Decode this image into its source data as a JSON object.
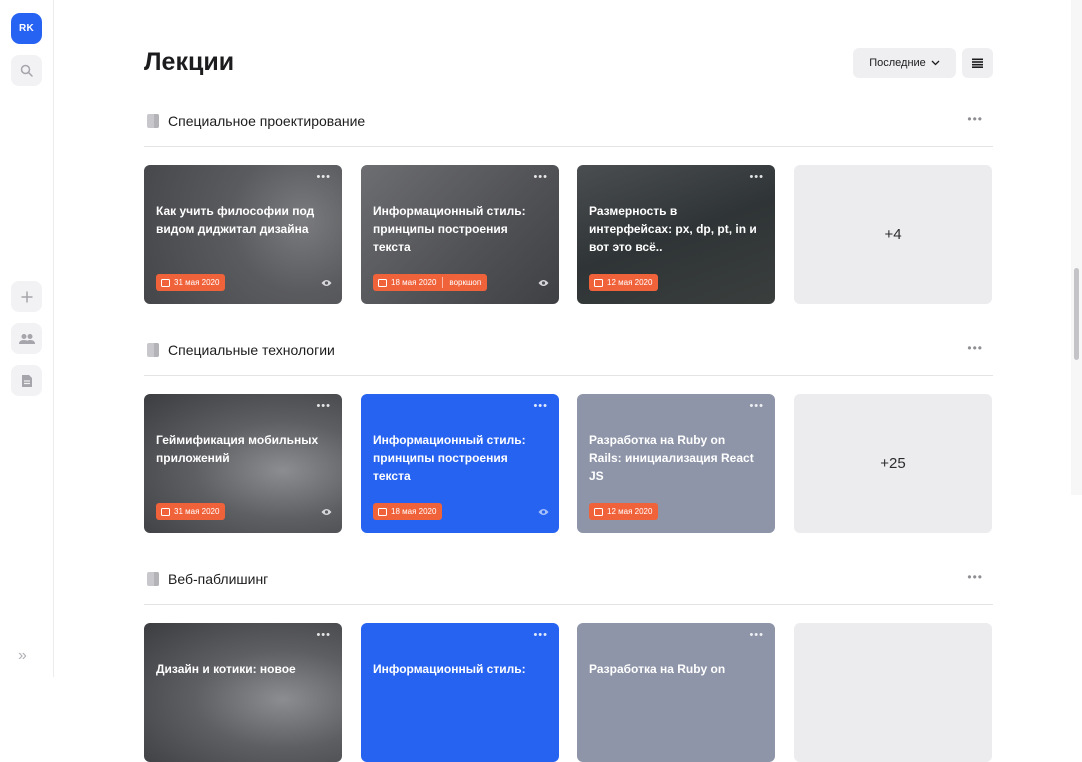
{
  "sidebar": {
    "avatar_initials": "RK",
    "buttons": [
      {
        "name": "search-icon"
      },
      {
        "name": "plus-icon"
      },
      {
        "name": "users-icon"
      },
      {
        "name": "document-icon"
      }
    ],
    "expand_label": "»"
  },
  "header": {
    "title": "Лекции",
    "sort_label": "Последние",
    "view_icon": "list-icon"
  },
  "sections": [
    {
      "title": "Специальное проектирование",
      "more": "•••",
      "cards": [
        {
          "title": "Как учить философии под видом диджитал дизайна",
          "date": "31 мая 2020",
          "extra": "",
          "style": "photo",
          "eye": true
        },
        {
          "title": "Информационный стиль: принципы построения текста",
          "date": "18 мая 2020",
          "extra": "воркшоп",
          "style": "photo",
          "eye": true
        },
        {
          "title": "Размерность в интерфейсах: px, dp, pt, in и вот это всё..",
          "date": "12 мая 2020",
          "extra": "",
          "style": "photo",
          "eye": false
        }
      ],
      "more_count": "+4"
    },
    {
      "title": "Специальные технологии",
      "more": "•••",
      "cards": [
        {
          "title": "Геймификация мобильных приложений",
          "date": "31 мая 2020",
          "extra": "",
          "style": "photo",
          "eye": true
        },
        {
          "title": "Информационный стиль: принципы построения текста",
          "date": "18 мая 2020",
          "extra": "",
          "style": "blue",
          "eye": true
        },
        {
          "title": "Разработка на Ruby on Rails: инициализация React JS",
          "date": "12 мая 2020",
          "extra": "",
          "style": "slate",
          "eye": false
        }
      ],
      "more_count": "+25"
    },
    {
      "title": "Веб-паблишинг",
      "more": "•••",
      "cards": [
        {
          "title": "Дизайн и котики: новое",
          "style": "photo"
        },
        {
          "title": "Информационный стиль:",
          "style": "blue"
        },
        {
          "title": "Разработка на Ruby on",
          "style": "slate"
        }
      ],
      "more_count": ""
    }
  ],
  "colors": {
    "accent": "#2763f1",
    "tag": "#f0623a",
    "slate_card": "#8e95a8",
    "count_card": "#ececef"
  }
}
